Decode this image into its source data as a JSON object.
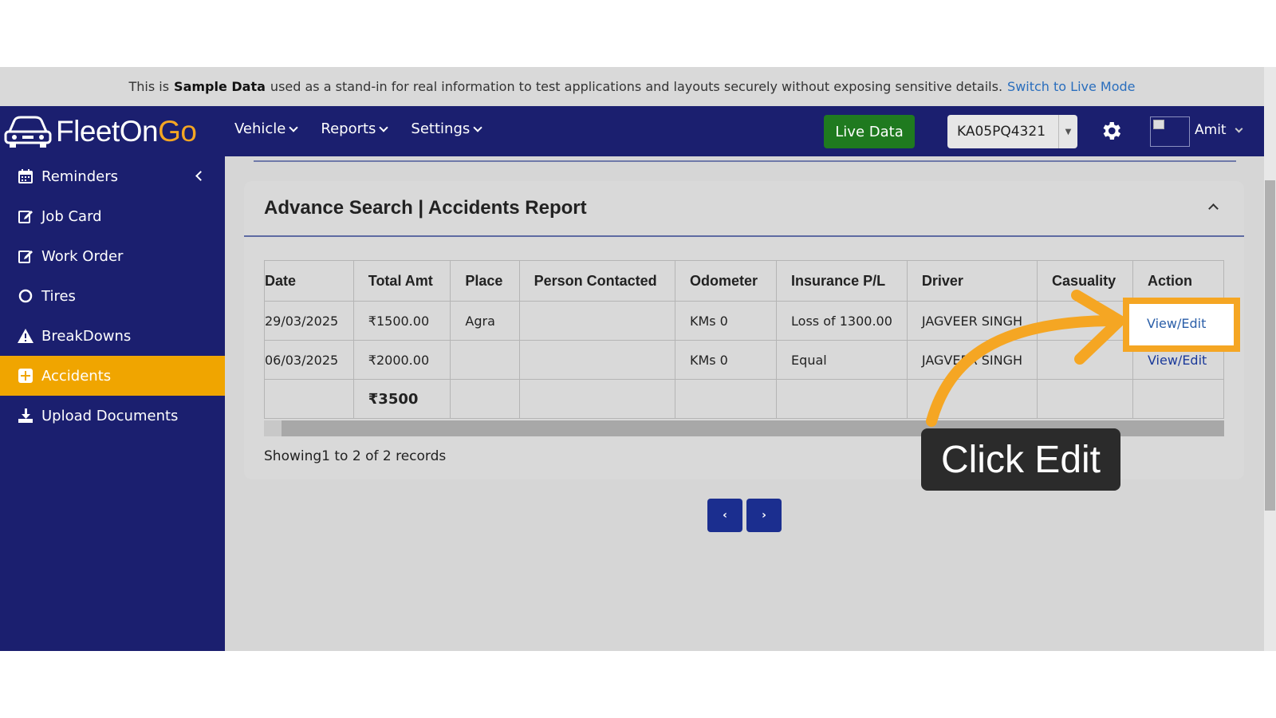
{
  "banner": {
    "prefix": "This is",
    "bold": "Sample Data",
    "message": "used as a stand-in for real information to test applications and layouts securely without exposing sensitive details.",
    "link": "Switch to Live Mode"
  },
  "navbar": {
    "logo_main": "FleetOn",
    "logo_accent": "Go",
    "menu": [
      "Vehicle",
      "Reports",
      "Settings"
    ],
    "live_button": "Live Data",
    "vehicle_selected": "KA05PQ4321",
    "user_name": "Amit"
  },
  "sidebar": {
    "items": [
      {
        "label": "Reminders",
        "icon": "calendar-icon"
      },
      {
        "label": "Job Card",
        "icon": "edit-icon"
      },
      {
        "label": "Work Order",
        "icon": "edit-icon"
      },
      {
        "label": "Tires",
        "icon": "circle-icon"
      },
      {
        "label": "BreakDowns",
        "icon": "warning-icon"
      },
      {
        "label": "Accidents",
        "icon": "plus-square-icon",
        "active": true
      },
      {
        "label": "Upload Documents",
        "icon": "download-icon"
      }
    ],
    "active_color": "#f0a500",
    "bg_color": "#1b1f6f"
  },
  "card": {
    "title": "Advance Search | Accidents Report"
  },
  "table": {
    "headers": [
      "Date",
      "Total Amt",
      "Place",
      "Person Contacted",
      "Odometer",
      "Insurance P/L",
      "Driver",
      "Casuality",
      "Action"
    ],
    "rows": [
      {
        "date": "29/03/2025",
        "amount": "₹1500.00",
        "place": "Agra",
        "person": "",
        "odometer": "KMs 0",
        "insurance": "Loss of 1300.00",
        "driver": "JAGVEER SINGH",
        "casuality": "",
        "action": "View/Edit"
      },
      {
        "date": "06/03/2025",
        "amount": "₹2000.00",
        "place": "",
        "person": "",
        "odometer": "KMs 0",
        "insurance": "Equal",
        "driver": "JAGVEER SINGH",
        "casuality": "",
        "action": "View/Edit"
      }
    ],
    "total": "₹3500"
  },
  "records_text": "Showing1 to 2 of 2 records",
  "pager": {
    "prev": "‹",
    "next": "›"
  },
  "annotation": {
    "tooltip": "Click Edit",
    "color": "#f5a623"
  }
}
